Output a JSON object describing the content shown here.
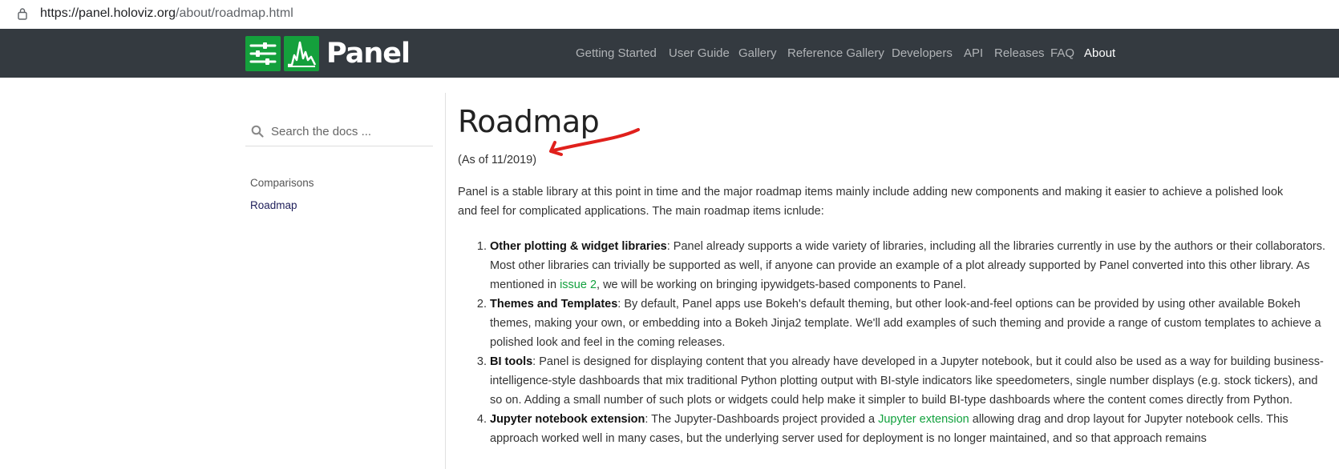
{
  "browser": {
    "url_host": "https://panel.holoviz.org",
    "url_path": "/about/roadmap.html"
  },
  "brand": {
    "name": "Panel",
    "accent": "#14a03c",
    "navbar_bg": "#343a40"
  },
  "nav": {
    "items": [
      {
        "label": "Getting Started"
      },
      {
        "label": "User Guide"
      },
      {
        "label": "Gallery"
      },
      {
        "label": "Reference Gallery"
      },
      {
        "label": "Developers"
      },
      {
        "label": "API"
      },
      {
        "label": "Releases"
      },
      {
        "label": "FAQ"
      },
      {
        "label": "About"
      }
    ],
    "active": "About"
  },
  "sidebar": {
    "search_placeholder": "Search the docs ...",
    "links": [
      {
        "label": "Comparisons"
      },
      {
        "label": "Roadmap"
      }
    ],
    "current": "Roadmap"
  },
  "page": {
    "title": "Roadmap",
    "as_of": "(As of 11/2019)",
    "intro": "Panel is a stable library at this point in time and the major roadmap items mainly include adding new components and making it easier to achieve a polished look and feel for complicated applications. The main roadmap items icnlude:",
    "items": [
      {
        "heading": "Other plotting & widget libraries",
        "text_before": ": Panel already supports a wide variety of libraries, including all the libraries currently in use by the authors or their collaborators. Most other libraries can trivially be supported as well, if anyone can provide an example of a plot already supported by Panel converted into this other library. As mentioned in ",
        "link": "issue 2",
        "text_after": ", we will be working on bringing ipywidgets-based components to Panel."
      },
      {
        "heading": "Themes and Templates",
        "text_before": ": By default, Panel apps use Bokeh's default theming, but other look-and-feel options can be provided by using other available Bokeh themes, making your own, or embedding into a Bokeh Jinja2 template. We'll add examples of such theming and provide a range of custom templates to achieve a polished look and feel in the coming releases.",
        "link": "",
        "text_after": ""
      },
      {
        "heading": "BI tools",
        "text_before": ": Panel is designed for displaying content that you already have developed in a Jupyter notebook, but it could also be used as a way for building business-intelligence-style dashboards that mix traditional Python plotting output with BI-style indicators like speedometers, single number displays (e.g. stock tickers), and so on. Adding a small number of such plots or widgets could help make it simpler to build BI-type dashboards where the content comes directly from Python.",
        "link": "",
        "text_after": ""
      },
      {
        "heading": "Jupyter notebook extension",
        "text_before": ": The Jupyter-Dashboards project provided a ",
        "link": "Jupyter extension",
        "text_after": " allowing drag and drop layout for Jupyter notebook cells. This approach worked well in many cases, but the underlying server used for deployment is no longer maintained, and so that approach remains"
      }
    ]
  },
  "annotation": {
    "arrow_color": "#e0201c"
  }
}
